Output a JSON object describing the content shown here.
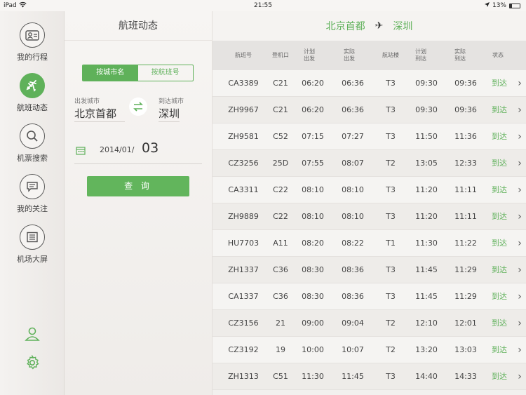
{
  "statusbar": {
    "device": "iPad",
    "time": "21:55",
    "battery": "13%"
  },
  "nav": {
    "items": [
      {
        "label": "我的行程",
        "icon": "itinerary-card-icon"
      },
      {
        "label": "航班动态",
        "icon": "airplane-icon",
        "active": true
      },
      {
        "label": "机票搜索",
        "icon": "search-icon"
      },
      {
        "label": "我的关注",
        "icon": "message-icon"
      },
      {
        "label": "机场大屏",
        "icon": "board-icon"
      }
    ],
    "bottom": [
      "user-icon",
      "gear-icon"
    ]
  },
  "panel": {
    "title": "航班动态",
    "tabs": [
      "按城市名",
      "按航班号"
    ],
    "depart_label": "出发城市",
    "depart_city": "北京首都",
    "arrive_label": "到达城市",
    "arrive_city": "深圳",
    "date_prefix": "2014/01/",
    "date_day": "03",
    "query_button": "查 询"
  },
  "route": {
    "from": "北京首都",
    "to": "深圳",
    "plane": "✈"
  },
  "table": {
    "headers": {
      "flight": "航班号",
      "gate": "登机口",
      "plan_dep": "计划\n出发",
      "act_dep": "实际\n出发",
      "terminal": "航站楼",
      "plan_arr": "计划\n到达",
      "act_arr": "实际\n到达",
      "status": "状态"
    },
    "rows": [
      {
        "flight": "CA3389",
        "gate": "C21",
        "plan_dep": "06:20",
        "act_dep": "06:36",
        "terminal": "T3",
        "plan_arr": "09:30",
        "act_arr": "09:36",
        "status": "到达"
      },
      {
        "flight": "ZH9967",
        "gate": "C21",
        "plan_dep": "06:20",
        "act_dep": "06:36",
        "terminal": "T3",
        "plan_arr": "09:30",
        "act_arr": "09:36",
        "status": "到达"
      },
      {
        "flight": "ZH9581",
        "gate": "C52",
        "plan_dep": "07:15",
        "act_dep": "07:27",
        "terminal": "T3",
        "plan_arr": "11:50",
        "act_arr": "11:36",
        "status": "到达"
      },
      {
        "flight": "CZ3256",
        "gate": "25D",
        "plan_dep": "07:55",
        "act_dep": "08:07",
        "terminal": "T2",
        "plan_arr": "13:05",
        "act_arr": "12:33",
        "status": "到达"
      },
      {
        "flight": "CA3311",
        "gate": "C22",
        "plan_dep": "08:10",
        "act_dep": "08:10",
        "terminal": "T3",
        "plan_arr": "11:20",
        "act_arr": "11:11",
        "status": "到达"
      },
      {
        "flight": "ZH9889",
        "gate": "C22",
        "plan_dep": "08:10",
        "act_dep": "08:10",
        "terminal": "T3",
        "plan_arr": "11:20",
        "act_arr": "11:11",
        "status": "到达"
      },
      {
        "flight": "HU7703",
        "gate": "A11",
        "plan_dep": "08:20",
        "act_dep": "08:22",
        "terminal": "T1",
        "plan_arr": "11:30",
        "act_arr": "11:22",
        "status": "到达"
      },
      {
        "flight": "ZH1337",
        "gate": "C36",
        "plan_dep": "08:30",
        "act_dep": "08:36",
        "terminal": "T3",
        "plan_arr": "11:45",
        "act_arr": "11:29",
        "status": "到达"
      },
      {
        "flight": "CA1337",
        "gate": "C36",
        "plan_dep": "08:30",
        "act_dep": "08:36",
        "terminal": "T3",
        "plan_arr": "11:45",
        "act_arr": "11:29",
        "status": "到达"
      },
      {
        "flight": "CZ3156",
        "gate": "21",
        "plan_dep": "09:00",
        "act_dep": "09:04",
        "terminal": "T2",
        "plan_arr": "12:10",
        "act_arr": "12:01",
        "status": "到达"
      },
      {
        "flight": "CZ3192",
        "gate": "19",
        "plan_dep": "10:00",
        "act_dep": "10:07",
        "terminal": "T2",
        "plan_arr": "13:20",
        "act_arr": "13:03",
        "status": "到达"
      },
      {
        "flight": "ZH1313",
        "gate": "C51",
        "plan_dep": "11:30",
        "act_dep": "11:45",
        "terminal": "T3",
        "plan_arr": "14:40",
        "act_arr": "14:33",
        "status": "到达"
      }
    ]
  },
  "colors": {
    "accent": "#5fb15a"
  }
}
